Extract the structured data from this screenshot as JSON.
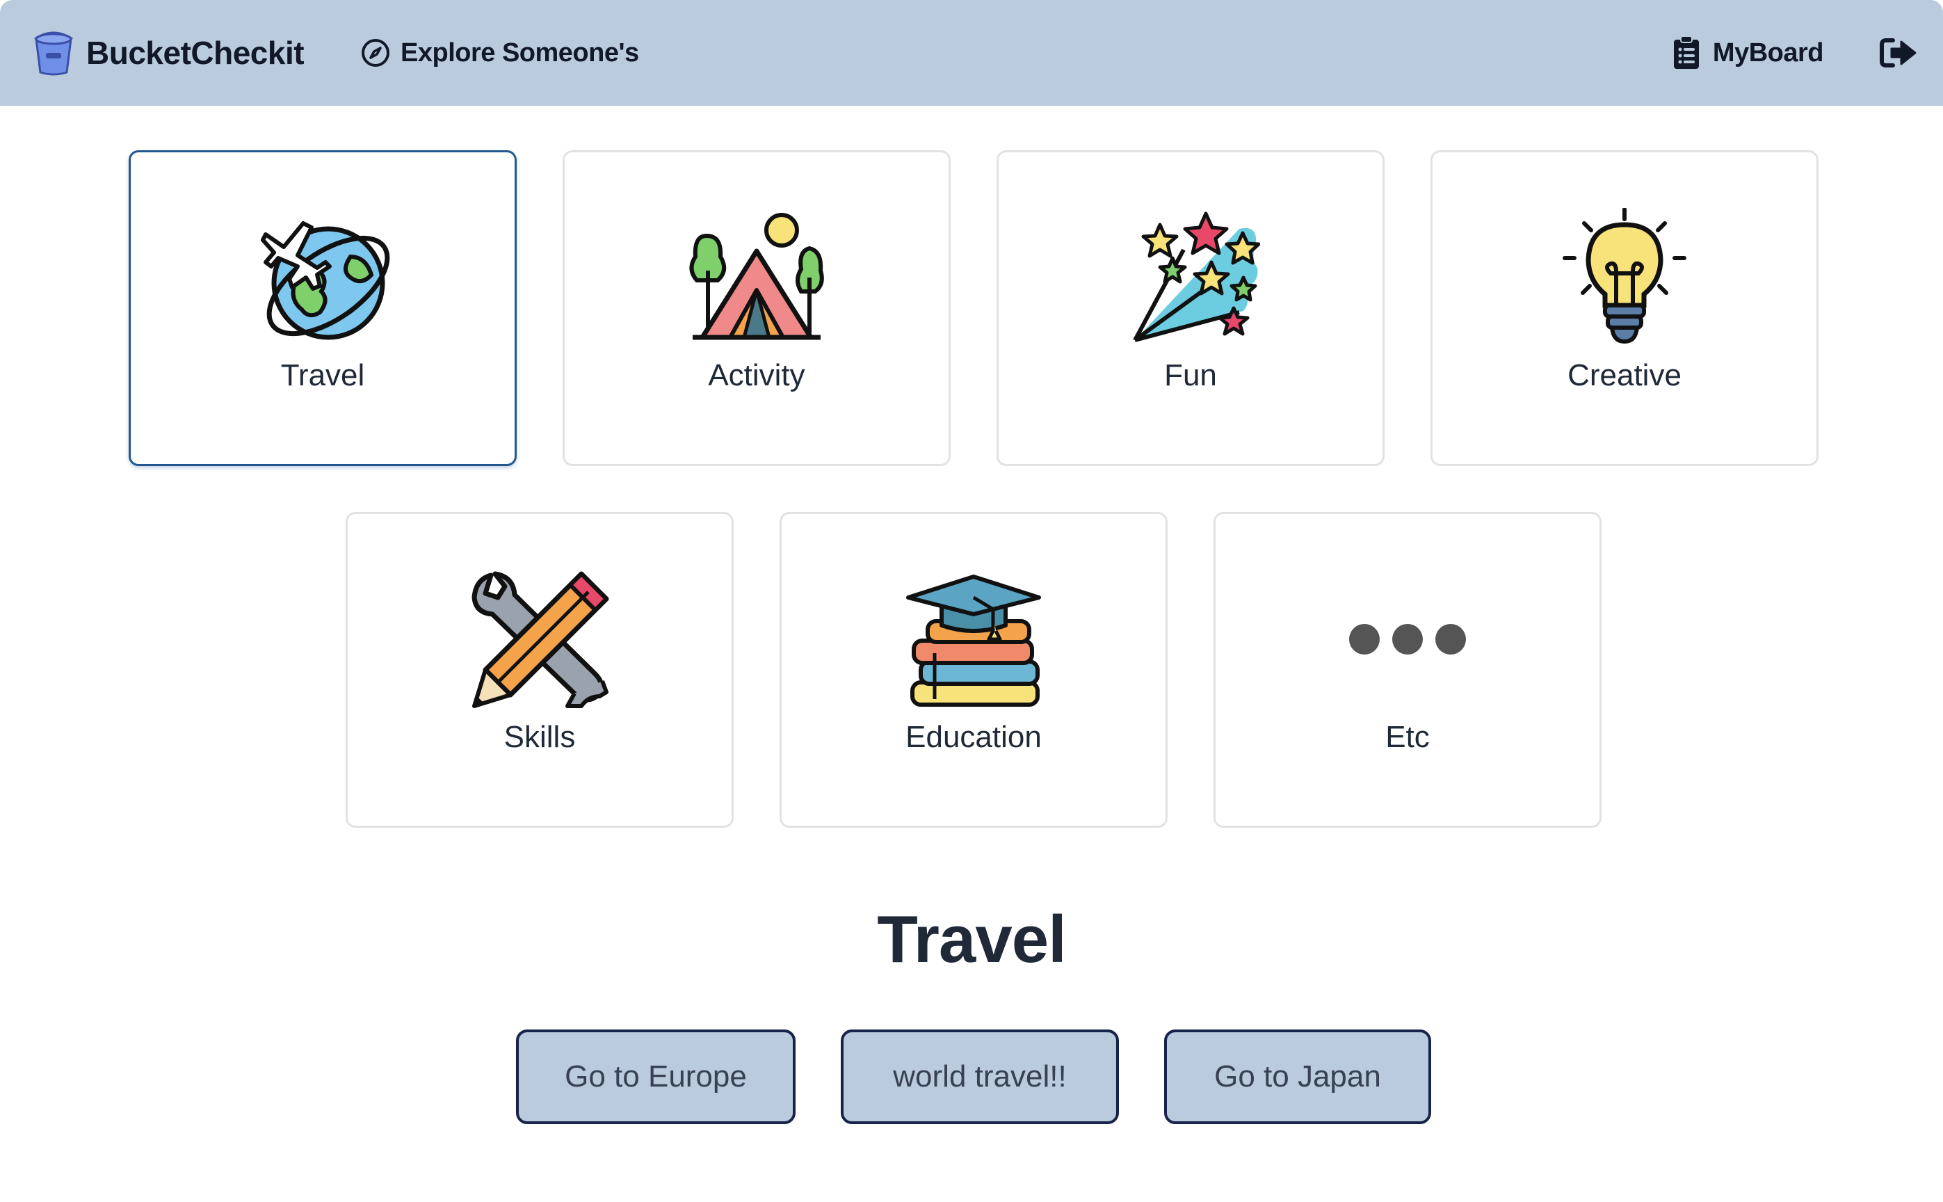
{
  "navbar": {
    "brand": "BucketCheckit",
    "explore": "Explore Someone's",
    "myboard": "MyBoard"
  },
  "categories": [
    {
      "label": "Travel",
      "icon": "globe-airplane-icon",
      "selected": true
    },
    {
      "label": "Activity",
      "icon": "camping-tent-icon",
      "selected": false
    },
    {
      "label": "Fun",
      "icon": "shooting-stars-icon",
      "selected": false
    },
    {
      "label": "Creative",
      "icon": "lightbulb-icon",
      "selected": false
    },
    {
      "label": "Skills",
      "icon": "wrench-pencil-icon",
      "selected": false
    },
    {
      "label": "Education",
      "icon": "graduation-books-icon",
      "selected": false
    },
    {
      "label": "Etc",
      "icon": "more-dots-icon",
      "selected": false
    }
  ],
  "selected_section": {
    "title": "Travel",
    "items": [
      "Go to Europe",
      "world travel!!",
      "Go to Japan"
    ]
  },
  "colors": {
    "navbar": "#b9cbdd",
    "selected_border": "#23578f",
    "button_border": "#17234a"
  }
}
